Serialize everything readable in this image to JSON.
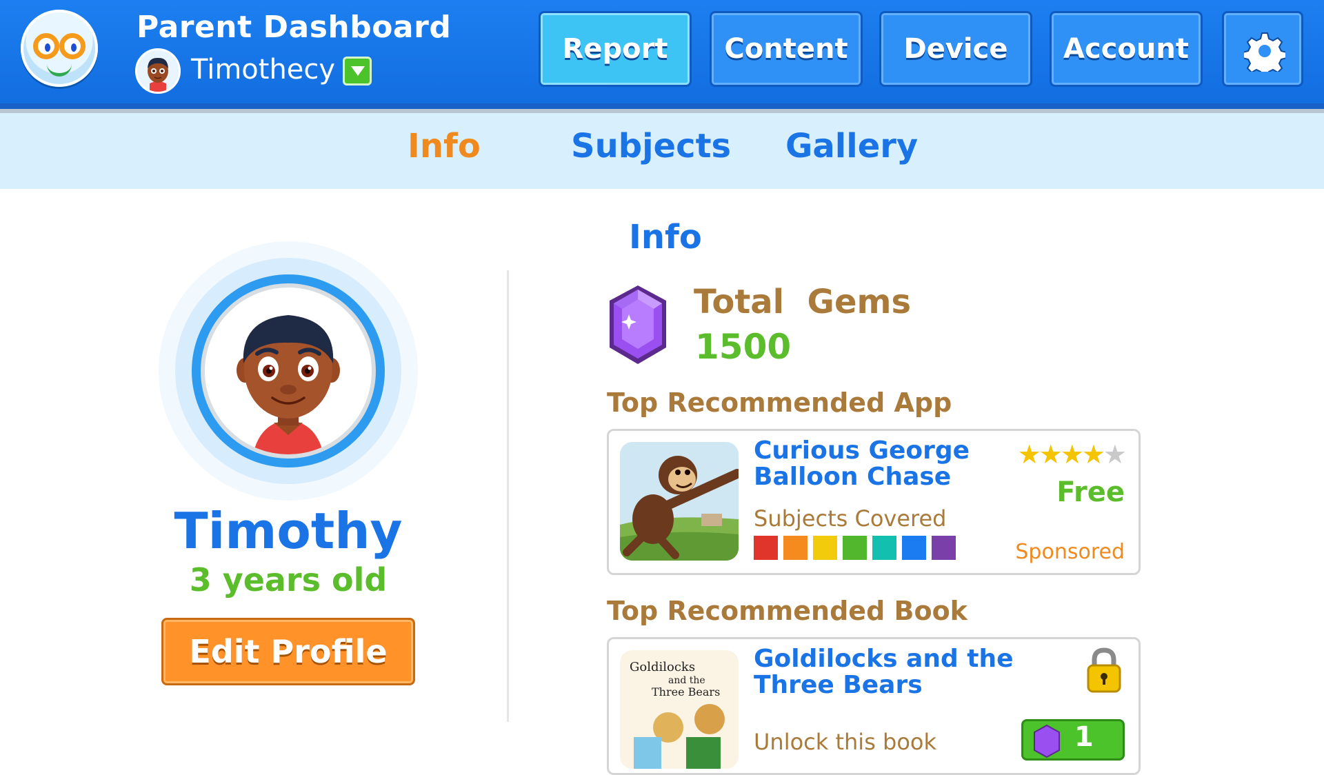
{
  "header": {
    "title": "Parent Dashboard",
    "child_selector": {
      "name": "Timothecy"
    },
    "nav": [
      {
        "label": "Report",
        "active": true
      },
      {
        "label": "Content",
        "active": false
      },
      {
        "label": "Device",
        "active": false
      },
      {
        "label": "Account",
        "active": false
      }
    ],
    "settings_icon": "gear-icon"
  },
  "subtabs": [
    {
      "label": "Info",
      "active": true
    },
    {
      "label": "Subjects",
      "active": false
    },
    {
      "label": "Gallery",
      "active": false
    }
  ],
  "profile": {
    "name": "Timothy",
    "age": "3 years old",
    "edit_label": "Edit Profile"
  },
  "info": {
    "title": "Info",
    "gems_label": "Total  Gems",
    "gems_value": "1500",
    "top_app_label": "Top Recommended App",
    "top_book_label": "Top Recommended Book"
  },
  "app": {
    "title_line1": "Curious George",
    "title_line2": "Balloon Chase",
    "rating": 4,
    "rating_max": 5,
    "price": "Free",
    "subjects_label": "Subjects Covered",
    "subject_colors": [
      "#e0352b",
      "#f58a1f",
      "#f2cc0c",
      "#52b72d",
      "#13bfae",
      "#1a7cf0",
      "#7a3fa8"
    ],
    "sponsored": "Sponsored"
  },
  "book": {
    "title_line1": "Goldilocks and the",
    "title_line2": "Three Bears",
    "cover_title_1": "Goldilocks",
    "cover_title_2": "and the",
    "cover_title_3": "Three Bears",
    "unlock_text": "Unlock this book",
    "unlock_cost": "1",
    "locked": true
  },
  "colors": {
    "primary_blue": "#1a74e6",
    "accent_orange": "#f08a1e",
    "green": "#5cbd2c",
    "brown": "#a97a3a"
  }
}
